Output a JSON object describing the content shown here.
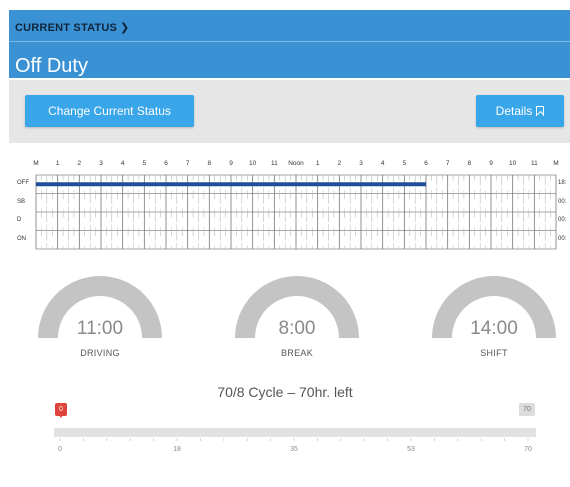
{
  "header": {
    "breadcrumb": "CURRENT STATUS",
    "breadcrumb_icon": "chevron-right-icon",
    "status": "Off Duty",
    "color": "#3a91d3"
  },
  "actions": {
    "change_status_label": "Change Current Status",
    "details_label": "Details",
    "details_icon": "bookmark-icon",
    "button_color": "#3aa6ea"
  },
  "log": {
    "hours": [
      "M",
      "1",
      "2",
      "3",
      "4",
      "5",
      "6",
      "7",
      "8",
      "9",
      "10",
      "11",
      "Noon",
      "1",
      "2",
      "3",
      "4",
      "5",
      "6",
      "7",
      "8",
      "9",
      "10",
      "11",
      "M"
    ],
    "rows": [
      {
        "label": "OFF",
        "total": "18:"
      },
      {
        "label": "SB",
        "total": "00:"
      },
      {
        "label": "D",
        "total": "00:"
      },
      {
        "label": "ON",
        "total": "00:"
      }
    ],
    "duty_line": {
      "row": "OFF",
      "start_hour": 0,
      "end_hour": 18.0
    },
    "duty_color": "#1f4f99"
  },
  "gauges": [
    {
      "value": "11:00",
      "label": "DRIVING"
    },
    {
      "value": "8:00",
      "label": "BREAK"
    },
    {
      "value": "14:00",
      "label": "SHIFT"
    }
  ],
  "cycle": {
    "title": "70/8 Cycle – 70hr. left",
    "current": "0",
    "max": "70",
    "ticks": [
      "0",
      "18",
      "35",
      "53",
      "70"
    ]
  }
}
